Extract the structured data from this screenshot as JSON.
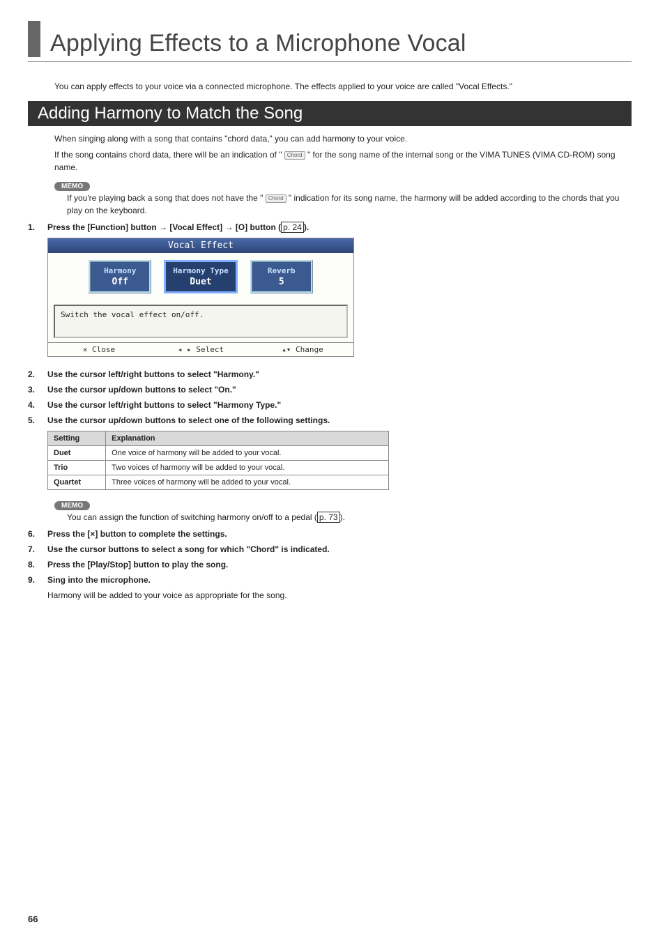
{
  "page_title": "Applying Effects to a Microphone Vocal",
  "intro": "You can apply effects to your voice via a connected microphone. The effects applied to your voice are called \"Vocal Effects.\"",
  "section_heading": "Adding Harmony to Match the Song",
  "para1": "When singing along with a song that contains \"chord data,\" you can add harmony to your voice.",
  "para2a": "If the song contains chord data, there will be an indication of \" ",
  "chord_chip": "Chord",
  "para2b": " \" for the song name of the internal song or the VIMA TUNES (VIMA CD-ROM) song name.",
  "memo_label": "MEMO",
  "memo1a": "If you're playing back a song that does not have the \" ",
  "memo1b": " \" indication for its song name, the harmony will be added according to the chords that you play on the keyboard.",
  "steps": {
    "1": {
      "num": "1.",
      "texta": "Press the [Function] button ",
      "arrow1": "→",
      "textb": " [Vocal Effect] ",
      "arrow2": "→",
      "textc": " [O] button (",
      "ref": "p. 24",
      "textd": ")."
    },
    "2": {
      "num": "2.",
      "text": "Use the cursor left/right buttons to select \"Harmony.\""
    },
    "3": {
      "num": "3.",
      "text": "Use the cursor up/down buttons to select \"On.\""
    },
    "4": {
      "num": "4.",
      "text": "Use the cursor left/right buttons to select \"Harmony Type.\""
    },
    "5": {
      "num": "5.",
      "text": "Use the cursor up/down buttons to select one of the following settings."
    },
    "6": {
      "num": "6.",
      "text": "Press the [×] button to complete the settings."
    },
    "7": {
      "num": "7.",
      "text": "Use the cursor buttons to select a song for which \"Chord\" is indicated."
    },
    "8": {
      "num": "8.",
      "text": "Press the [Play/Stop] button to play the song."
    },
    "9": {
      "num": "9.",
      "text": "Sing into the microphone."
    }
  },
  "screen": {
    "title": "Vocal Effect",
    "harmony": {
      "label": "Harmony",
      "value": "Off"
    },
    "type": {
      "label": "Harmony Type",
      "value": "Duet"
    },
    "reverb": {
      "label": "Reverb",
      "value": "5"
    },
    "desc": "Switch the vocal effect on/off.",
    "foot_close": "✕ Close",
    "foot_select": "◂ ▸ Select",
    "foot_change": "▴▾ Change"
  },
  "table": {
    "h1": "Setting",
    "h2": "Explanation",
    "rows": [
      {
        "s": "Duet",
        "e": "One voice of harmony will be added to your vocal."
      },
      {
        "s": "Trio",
        "e": "Two voices of harmony will be added to your vocal."
      },
      {
        "s": "Quartet",
        "e": "Three voices of harmony will be added to your vocal."
      }
    ]
  },
  "memo2a": "You can assign the function of switching harmony on/off to a pedal (",
  "memo2ref": "p. 73",
  "memo2b": ").",
  "step9_sub": "Harmony will be added to your voice as appropriate for the song.",
  "page_number": "66"
}
